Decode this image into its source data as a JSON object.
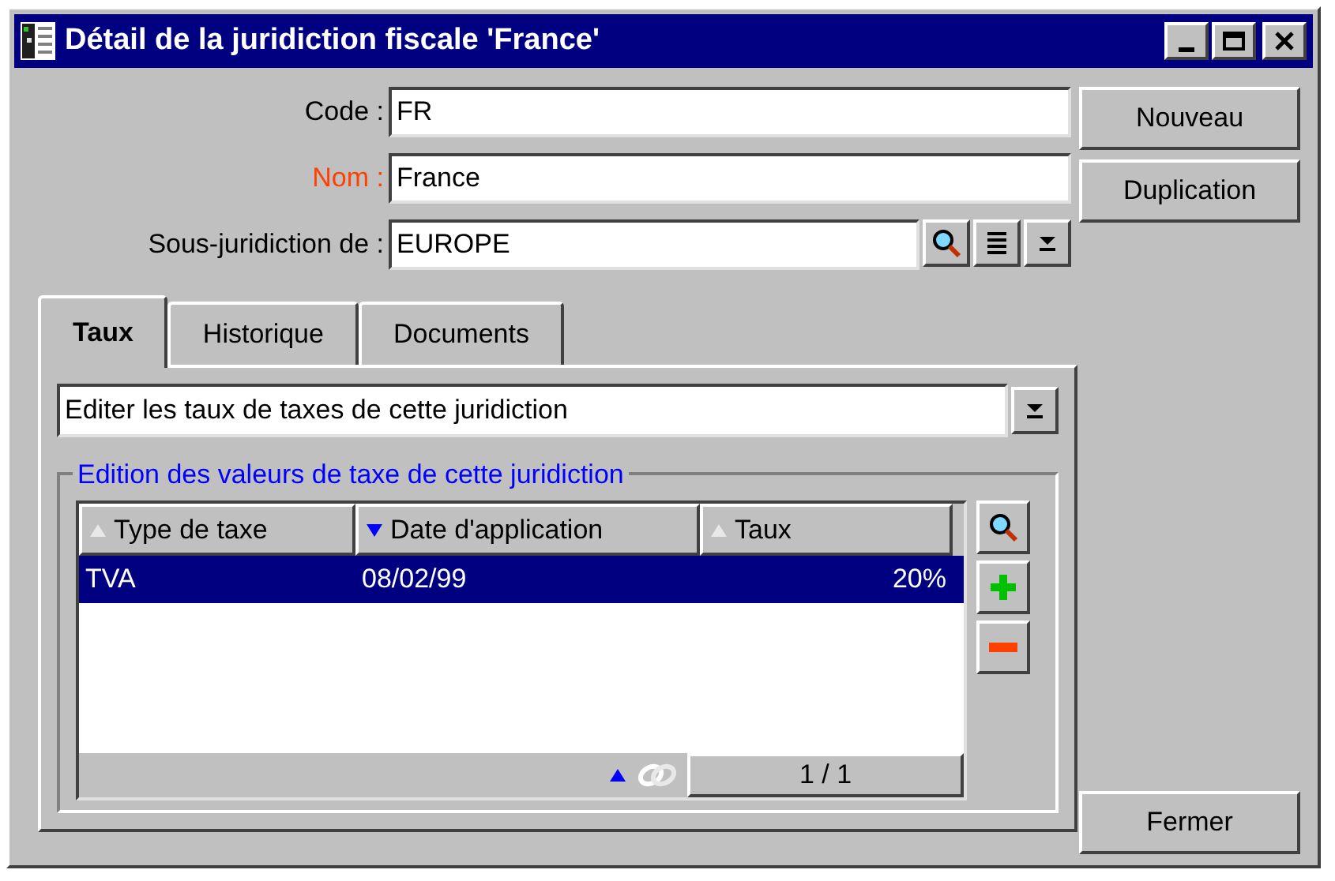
{
  "window": {
    "title": "Détail de la juridiction fiscale 'France'"
  },
  "fields": [
    {
      "label": "Code :",
      "value": "FR",
      "required": false,
      "kind": "text"
    },
    {
      "label": "Nom :",
      "value": "France",
      "required": true,
      "kind": "text"
    },
    {
      "label": "Sous-juridiction de :",
      "value": "EUROPE",
      "required": false,
      "kind": "lookup"
    }
  ],
  "side_buttons": [
    "Nouveau",
    "Duplication"
  ],
  "tabs": [
    {
      "label": "Taux",
      "selected": true
    },
    {
      "label": "Historique",
      "selected": false
    },
    {
      "label": "Documents",
      "selected": false
    }
  ],
  "mode_select": {
    "value": "Editer les taux de taxes de cette juridiction"
  },
  "group": {
    "title": "Edition des valeurs de taxe de cette juridiction"
  },
  "table": {
    "columns": [
      {
        "label": "Type de taxe",
        "sorted": false
      },
      {
        "label": "Date d'application",
        "sorted": true
      },
      {
        "label": "Taux",
        "sorted": false
      }
    ],
    "rows": [
      {
        "cells": [
          "TVA",
          "08/02/99",
          "20%"
        ],
        "selected": true
      }
    ],
    "pager": "1 / 1"
  },
  "close_button": "Fermer"
}
